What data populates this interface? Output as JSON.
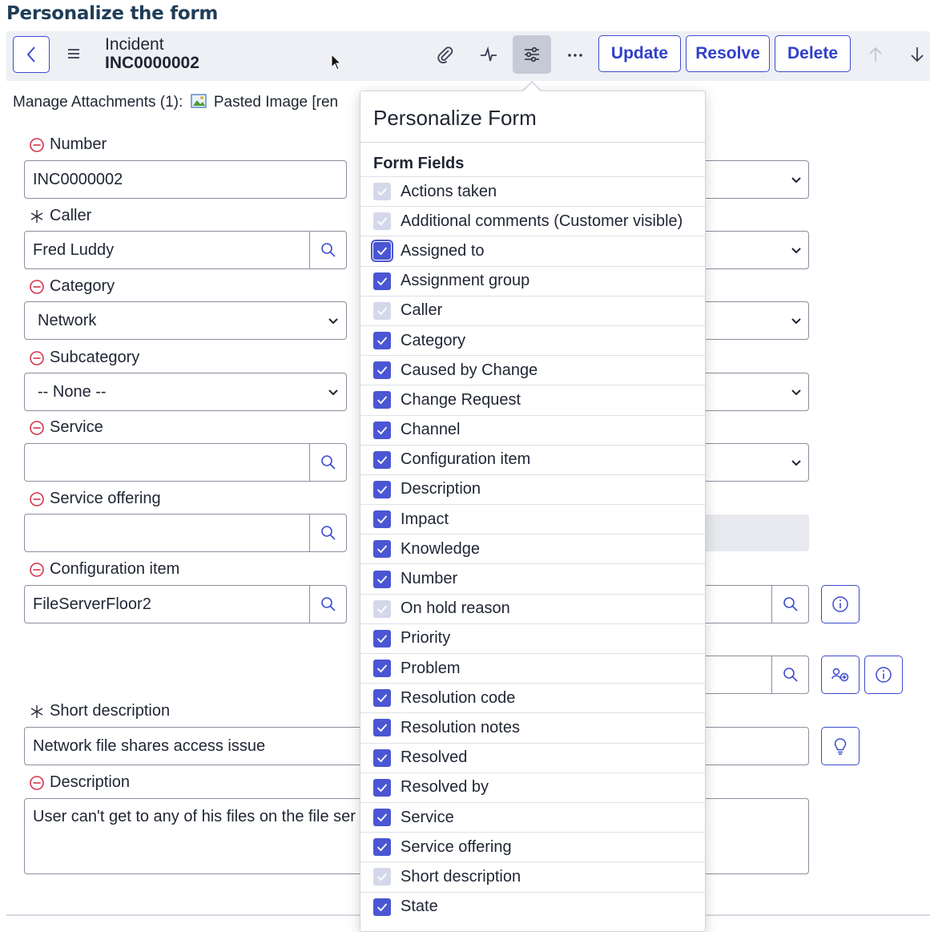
{
  "page_heading": "Personalize the form",
  "header": {
    "title_line1": "Incident",
    "title_line2": "INC0000002",
    "buttons": {
      "update": "Update",
      "resolve": "Resolve",
      "delete": "Delete"
    }
  },
  "attachments": {
    "label": "Manage Attachments (1):",
    "file": "Pasted Image [ren"
  },
  "form": {
    "number": {
      "label": "Number",
      "value": "INC0000002"
    },
    "caller": {
      "label": "Caller",
      "value": "Fred Luddy"
    },
    "category": {
      "label": "Category",
      "value": "Network"
    },
    "subcategory": {
      "label": "Subcategory",
      "value": "-- None --"
    },
    "service": {
      "label": "Service",
      "value": ""
    },
    "service_offering": {
      "label": "Service offering",
      "value": ""
    },
    "configuration_item": {
      "label": "Configuration item",
      "value": "FileServerFloor2"
    },
    "short_description": {
      "label": "Short description",
      "value": "Network file shares access issue"
    },
    "description": {
      "label": "Description",
      "value": "User can't get to any of his files on the file ser"
    }
  },
  "popover": {
    "title": "Personalize Form",
    "subtitle": "Form Fields",
    "fields": [
      {
        "label": "Actions taken",
        "state": "disabled"
      },
      {
        "label": "Additional comments (Customer visible)",
        "state": "disabled"
      },
      {
        "label": "Assigned to",
        "state": "checked-focus"
      },
      {
        "label": "Assignment group",
        "state": "checked"
      },
      {
        "label": "Caller",
        "state": "disabled"
      },
      {
        "label": "Category",
        "state": "checked"
      },
      {
        "label": "Caused by Change",
        "state": "checked"
      },
      {
        "label": "Change Request",
        "state": "checked"
      },
      {
        "label": "Channel",
        "state": "checked"
      },
      {
        "label": "Configuration item",
        "state": "checked"
      },
      {
        "label": "Description",
        "state": "checked"
      },
      {
        "label": "Impact",
        "state": "checked"
      },
      {
        "label": "Knowledge",
        "state": "checked"
      },
      {
        "label": "Number",
        "state": "checked"
      },
      {
        "label": "On hold reason",
        "state": "disabled"
      },
      {
        "label": "Priority",
        "state": "checked"
      },
      {
        "label": "Problem",
        "state": "checked"
      },
      {
        "label": "Resolution code",
        "state": "checked"
      },
      {
        "label": "Resolution notes",
        "state": "checked"
      },
      {
        "label": "Resolved",
        "state": "checked"
      },
      {
        "label": "Resolved by",
        "state": "checked"
      },
      {
        "label": "Service",
        "state": "checked"
      },
      {
        "label": "Service offering",
        "state": "checked"
      },
      {
        "label": "Short description",
        "state": "disabled"
      },
      {
        "label": "State",
        "state": "checked"
      }
    ]
  },
  "colors": {
    "accent": "#3c4bd0",
    "checkbox_on": "#4a56d3",
    "checkbox_disabled": "#d5d8ea",
    "header_bg": "#eef0f5",
    "mandatory_red": "#d6334a"
  }
}
